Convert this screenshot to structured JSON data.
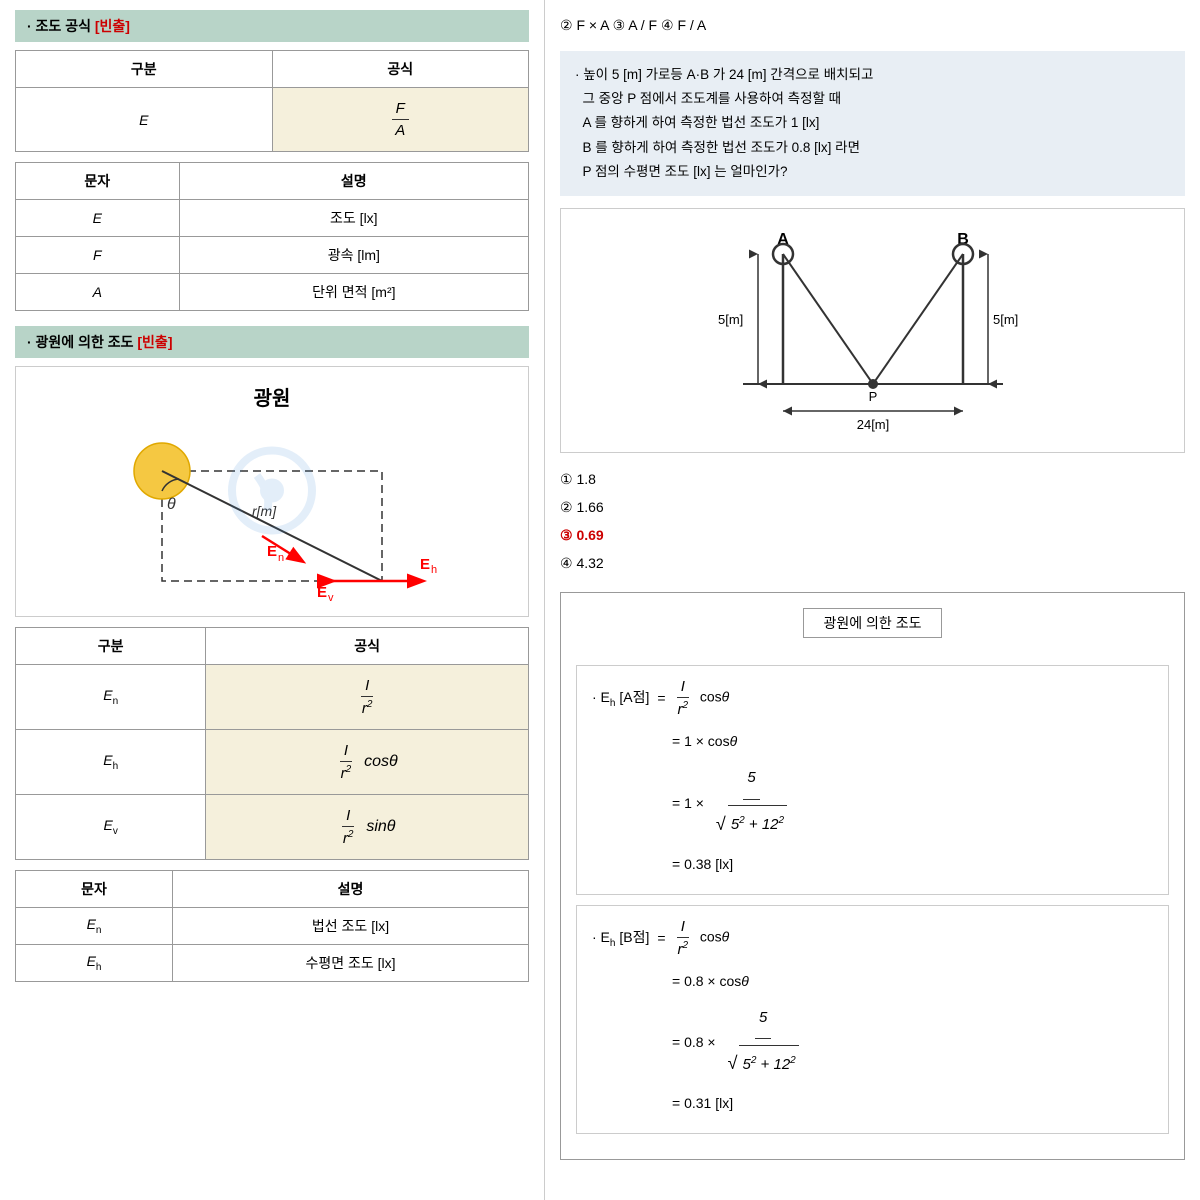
{
  "left": {
    "section1": {
      "header": "· 조도 공식 [빈출]",
      "table1": {
        "headers": [
          "구분",
          "공식"
        ],
        "rows": [
          {
            "label": "E",
            "formula": "F/A"
          }
        ]
      },
      "table2": {
        "headers": [
          "문자",
          "설명"
        ],
        "rows": [
          {
            "label": "E",
            "desc": "조도 [lx]"
          },
          {
            "label": "F",
            "desc": "광속 [lm]"
          },
          {
            "label": "A",
            "desc": "단위 면적 [m²]"
          }
        ]
      }
    },
    "section2": {
      "header": "· 광원에 의한 조도 [빈출]",
      "diagram_title": "광원",
      "table1": {
        "headers": [
          "구분",
          "공식"
        ],
        "rows": [
          {
            "label": "E_n",
            "formula": "I/r²"
          },
          {
            "label": "E_h",
            "formula": "I/r² cosθ"
          },
          {
            "label": "E_v",
            "formula": "I/r² sinθ"
          }
        ]
      },
      "table2": {
        "headers": [
          "문자",
          "설명"
        ],
        "rows": [
          {
            "label": "E_n",
            "desc": "법선 조도 [lx]"
          },
          {
            "label": "E_h",
            "desc": "수평면 조도 [lx]"
          }
        ]
      }
    }
  },
  "right": {
    "top_answers": {
      "ans2": "② F × A",
      "ans3": "③ A / F",
      "ans4": "④ F / A"
    },
    "question": {
      "text": "· 높이 5 [m] 가로등 A·B 가 24 [m] 간격으로 배치되고 그 중앙 P 점에서 조도계를 사용하여 측정할 때 A 를 향하게 하여 측정한 법선 조도가 1 [lx] B 를 향하게 하여 측정한 법선 조도가 0.8 [lx] 라면 P 점의 수평면 조도 [lx] 는 얼마인가?"
    },
    "answers": [
      {
        "num": "①",
        "val": "1.8",
        "correct": false
      },
      {
        "num": "②",
        "val": "1.66",
        "correct": false
      },
      {
        "num": "③",
        "val": "0.69",
        "correct": true
      },
      {
        "num": "④",
        "val": "4.32",
        "correct": false
      }
    ],
    "solution": {
      "title": "광원에 의한 조도",
      "eh_a_label": "· E_h [A점]",
      "eh_a_eq1": "= I/r² cosθ",
      "eh_a_eq2": "= 1 × cosθ",
      "eh_a_eq3_num": "5",
      "eh_a_eq3_sqrt": "5² + 12²",
      "eh_a_eq4": "= 0.38 [lx]",
      "eh_b_label": "· E_h [B점]",
      "eh_b_eq1": "= I/r² cosθ",
      "eh_b_eq2": "= 0.8 × cosθ",
      "eh_b_eq3_num": "5",
      "eh_b_eq3_sqrt": "5² + 12²",
      "eh_b_eq4": "= 0.31 [lx]"
    }
  }
}
